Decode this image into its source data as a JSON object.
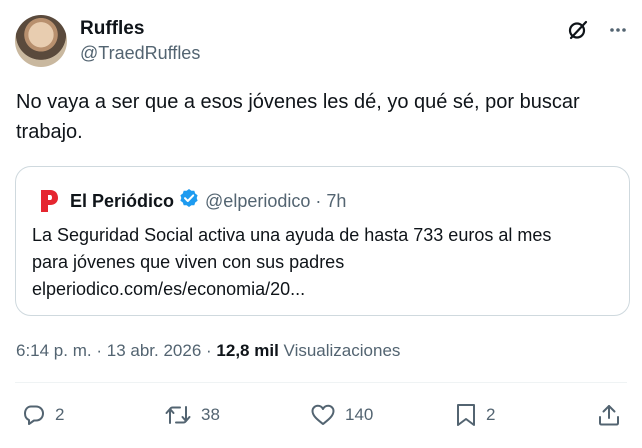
{
  "author": {
    "name": "Ruffles",
    "handle": "@TraedRuffles"
  },
  "tweet": {
    "text": "No vaya a ser que a esos jóvenes les dé, yo qué sé, por buscar trabajo."
  },
  "quote": {
    "name": "El Periódico",
    "handle": "@elperiodico",
    "time": "· 7h",
    "text_line1": "La Seguridad Social activa una ayuda de hasta 733 euros al mes",
    "text_line2": "para jóvenes que viven con sus padres",
    "text_line3": "elperiodico.com/es/economia/20..."
  },
  "meta": {
    "time": "6:14 p. m.",
    "sep1": "·",
    "date": "13 abr. 2026",
    "sep2": "·",
    "views_count": "12,8 mil",
    "views_label": "Visualizaciones"
  },
  "actions": {
    "replies": "2",
    "reposts": "38",
    "likes": "140",
    "bookmarks": "2"
  },
  "icons": {
    "top": [
      "grok-icon",
      "more-icon"
    ],
    "quote_logo": "el-periodico-logo-icon",
    "verified": "verified-badge-icon",
    "actions": [
      "reply-icon",
      "repost-icon",
      "like-icon",
      "bookmark-icon",
      "share-icon"
    ]
  },
  "colors": {
    "text": "#0f1419",
    "secondary": "#536471",
    "verified_blue": "#1d9bf0",
    "brand_red": "#e52630",
    "border": "#cfd9de"
  }
}
